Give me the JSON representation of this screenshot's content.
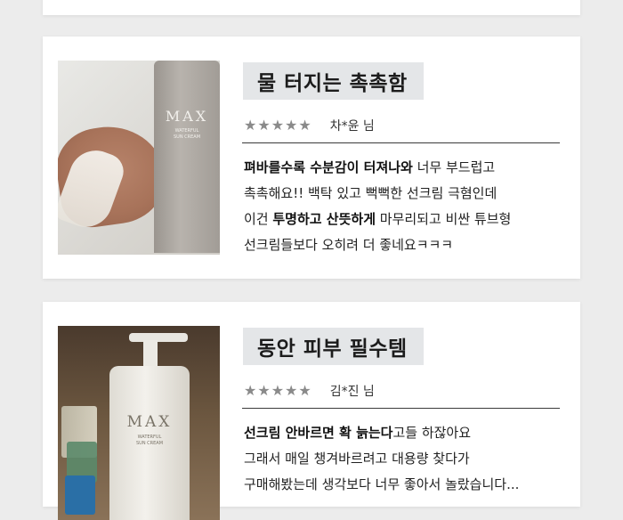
{
  "reviews": [
    {
      "title": "물 터지는 촉촉함",
      "stars": "★★★★★",
      "reviewer": "차*윤 님",
      "product": {
        "brand": "MAX",
        "sub_line1": "WATERFUL",
        "sub_line2": "SUN CREAM"
      },
      "body": [
        {
          "bold": "펴바를수록 수분감이 터져나와",
          "rest": " 너무 부드럽고"
        },
        {
          "bold": "",
          "rest": "촉촉해요!! 백탁 있고 뻑뻑한 선크림 극혐인데"
        },
        {
          "pre": "이건 ",
          "bold": "투명하고 산뜻하게",
          "rest": " 마무리되고 비싼 튜브형"
        },
        {
          "bold": "",
          "rest": "선크림들보다 오히려 더 좋네요ㅋㅋㅋ"
        }
      ]
    },
    {
      "title": "동안 피부 필수템",
      "stars": "★★★★★",
      "reviewer": "김*진 님",
      "product": {
        "brand": "MAX",
        "sub_line1": "WATERFUL",
        "sub_line2": "SUN CREAM"
      },
      "body": [
        {
          "bold": "선크림 안바르면 확 늙는다",
          "rest": "고들 하잖아요"
        },
        {
          "bold": "",
          "rest": "그래서 매일 챙겨바르려고 대용량 찾다가"
        },
        {
          "bold": "",
          "rest": "구매해봤는데 생각보다 너무 좋아서 놀랐습니다..."
        }
      ]
    }
  ],
  "colors": {
    "page_bg": "#ececec",
    "card_bg": "#ffffff",
    "title_bg": "#e4e6e8",
    "star": "#8a8a8a"
  }
}
